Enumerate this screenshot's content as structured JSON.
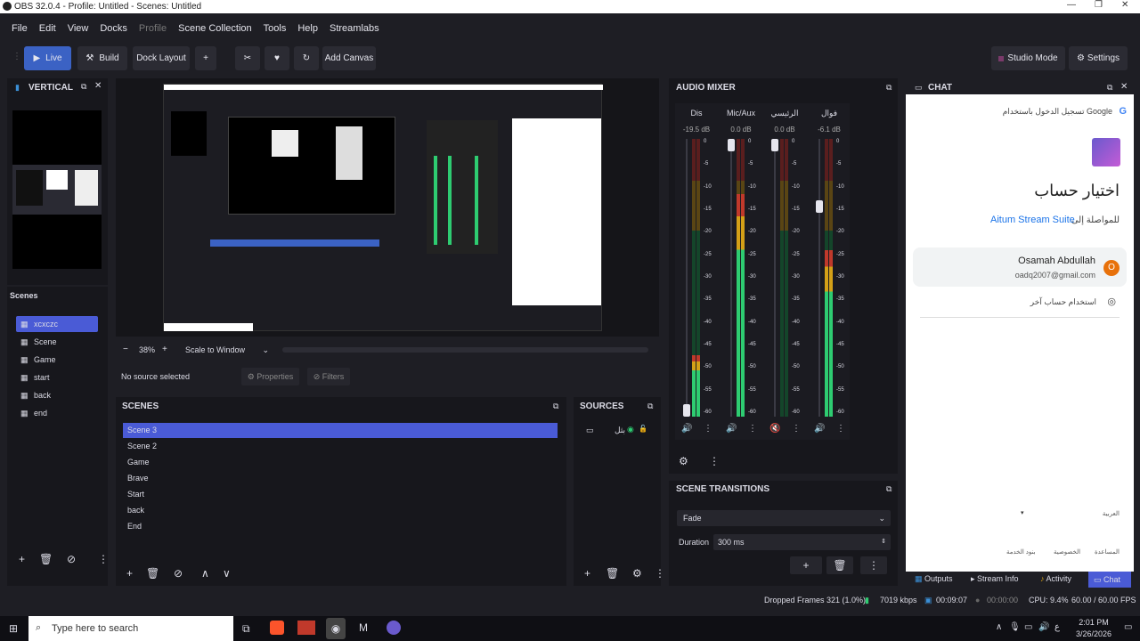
{
  "window": {
    "title": "OBS 32.0.4 - Profile: Untitled - Scenes: Untitled"
  },
  "menu": [
    "File",
    "Edit",
    "View",
    "Docks",
    "Profile",
    "Scene Collection",
    "Tools",
    "Help",
    "Streamlabs"
  ],
  "toolbar": {
    "live": "Live",
    "build": "Build",
    "dock_layout": "Dock Layout",
    "plus": "+",
    "add_canvas": "Add Canvas",
    "studio_mode": "Studio Mode",
    "settings": "Settings"
  },
  "vertical": {
    "title": "VERTICAL",
    "scenes_label": "Scenes",
    "scenes": [
      "xcxczc",
      "Scene",
      "Game",
      "start",
      "back",
      "end"
    ]
  },
  "preview": {
    "zoom": "38%",
    "minus": "−",
    "plus": "+",
    "scale": "Scale to Window"
  },
  "source_bar": {
    "no_source": "No source selected",
    "properties": "Properties",
    "filters": "Filters"
  },
  "scenes": {
    "title": "SCENES",
    "items": [
      "Scene 3",
      "Scene 2",
      "Game",
      "Brave",
      "Start",
      "back",
      "End"
    ],
    "selected": 0
  },
  "sources": {
    "title": "SOURCES",
    "items": [
      {
        "name": "بثل"
      }
    ]
  },
  "audio": {
    "title": "AUDIO MIXER",
    "channels": [
      {
        "name": "Dis",
        "db": "-19.5 dB",
        "level": 0.22,
        "fader": 0.0
      },
      {
        "name": "Mic/Aux",
        "db": "0.0 dB",
        "level": 0.8,
        "fader": 1.0
      },
      {
        "name": "الرئيسي",
        "db": "0.0 dB",
        "level": 0.0,
        "fader": 1.0,
        "muted": true
      },
      {
        "name": "فوال",
        "db": "-6.1 dB",
        "level": 0.6,
        "fader": 0.77
      }
    ],
    "ticks": [
      "0",
      "-5",
      "-10",
      "-15",
      "-20",
      "-25",
      "-30",
      "-35",
      "-40",
      "-45",
      "-50",
      "-55",
      "-60"
    ]
  },
  "transitions": {
    "title": "SCENE TRANSITIONS",
    "type": "Fade",
    "duration_label": "Duration",
    "duration": "300 ms"
  },
  "chat": {
    "title": "CHAT",
    "google_header": "تسجيل الدخول باستخدام Google",
    "heading": "اختيار حساب",
    "continue_to": "للمواصلة إلى",
    "app_name": "Aitum Stream Suite",
    "account_name": "Osamah Abdullah",
    "account_email": "oadq2007@gmail.com",
    "avatar_letter": "O",
    "other_account": "استخدام حساب آخر",
    "language": "العربية",
    "footer": [
      "المساعدة",
      "الخصوصية",
      "بنود الخدمة"
    ],
    "tabs": [
      "Outputs",
      "Stream Info",
      "Activity",
      "Chat"
    ]
  },
  "status": {
    "dropped": "Dropped Frames 321 (1.0%)",
    "kbps": "7019 kbps",
    "time1": "00:09:07",
    "time2": "00:00:00",
    "cpu": "CPU: 9.4%",
    "fps": "60.00 / 60.00 FPS"
  },
  "taskbar": {
    "search": "Type here to search",
    "time": "2:01 PM",
    "date": "3/26/2026"
  },
  "colors": {
    "accent": "#4a5bd6",
    "live": "#3b62c4",
    "meter_green": "#2ecc71",
    "meter_yellow": "#d4a017",
    "meter_red": "#c0392b"
  }
}
